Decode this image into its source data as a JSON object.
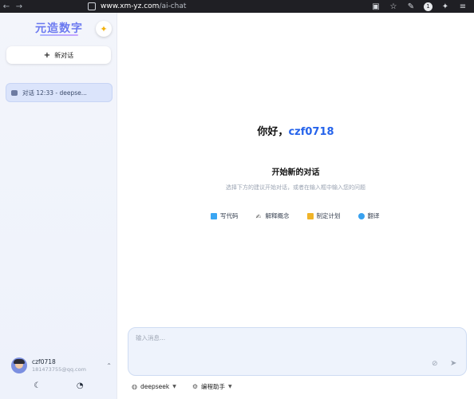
{
  "browser": {
    "back": "←",
    "forward": "→",
    "url_domain": "www.xm-yz.com",
    "url_path": "/ai-chat",
    "badge_count": "1"
  },
  "sidebar": {
    "brand": "元造数字",
    "new_chat_label": "新对话",
    "conversations": [
      {
        "label": "对话 12:33 - deepse..."
      }
    ],
    "user": {
      "name": "czf0718",
      "email": "181473755@qq.com"
    }
  },
  "main": {
    "greeting_prefix": "你好，",
    "greeting_name": "czf0718",
    "start_title": "开始新的对话",
    "start_subtitle": "选择下方的建议开始对话，或者在输入框中输入您的问题",
    "suggestions": [
      {
        "label": "写代码",
        "icon": "code-icon"
      },
      {
        "label": "解释概念",
        "icon": "concept-icon"
      },
      {
        "label": "制定计划",
        "icon": "plan-icon"
      },
      {
        "label": "翻译",
        "icon": "translate-icon"
      }
    ],
    "composer": {
      "placeholder": "输入消息..."
    },
    "model_selector": "deepseek",
    "assistant_selector": "编程助手"
  }
}
